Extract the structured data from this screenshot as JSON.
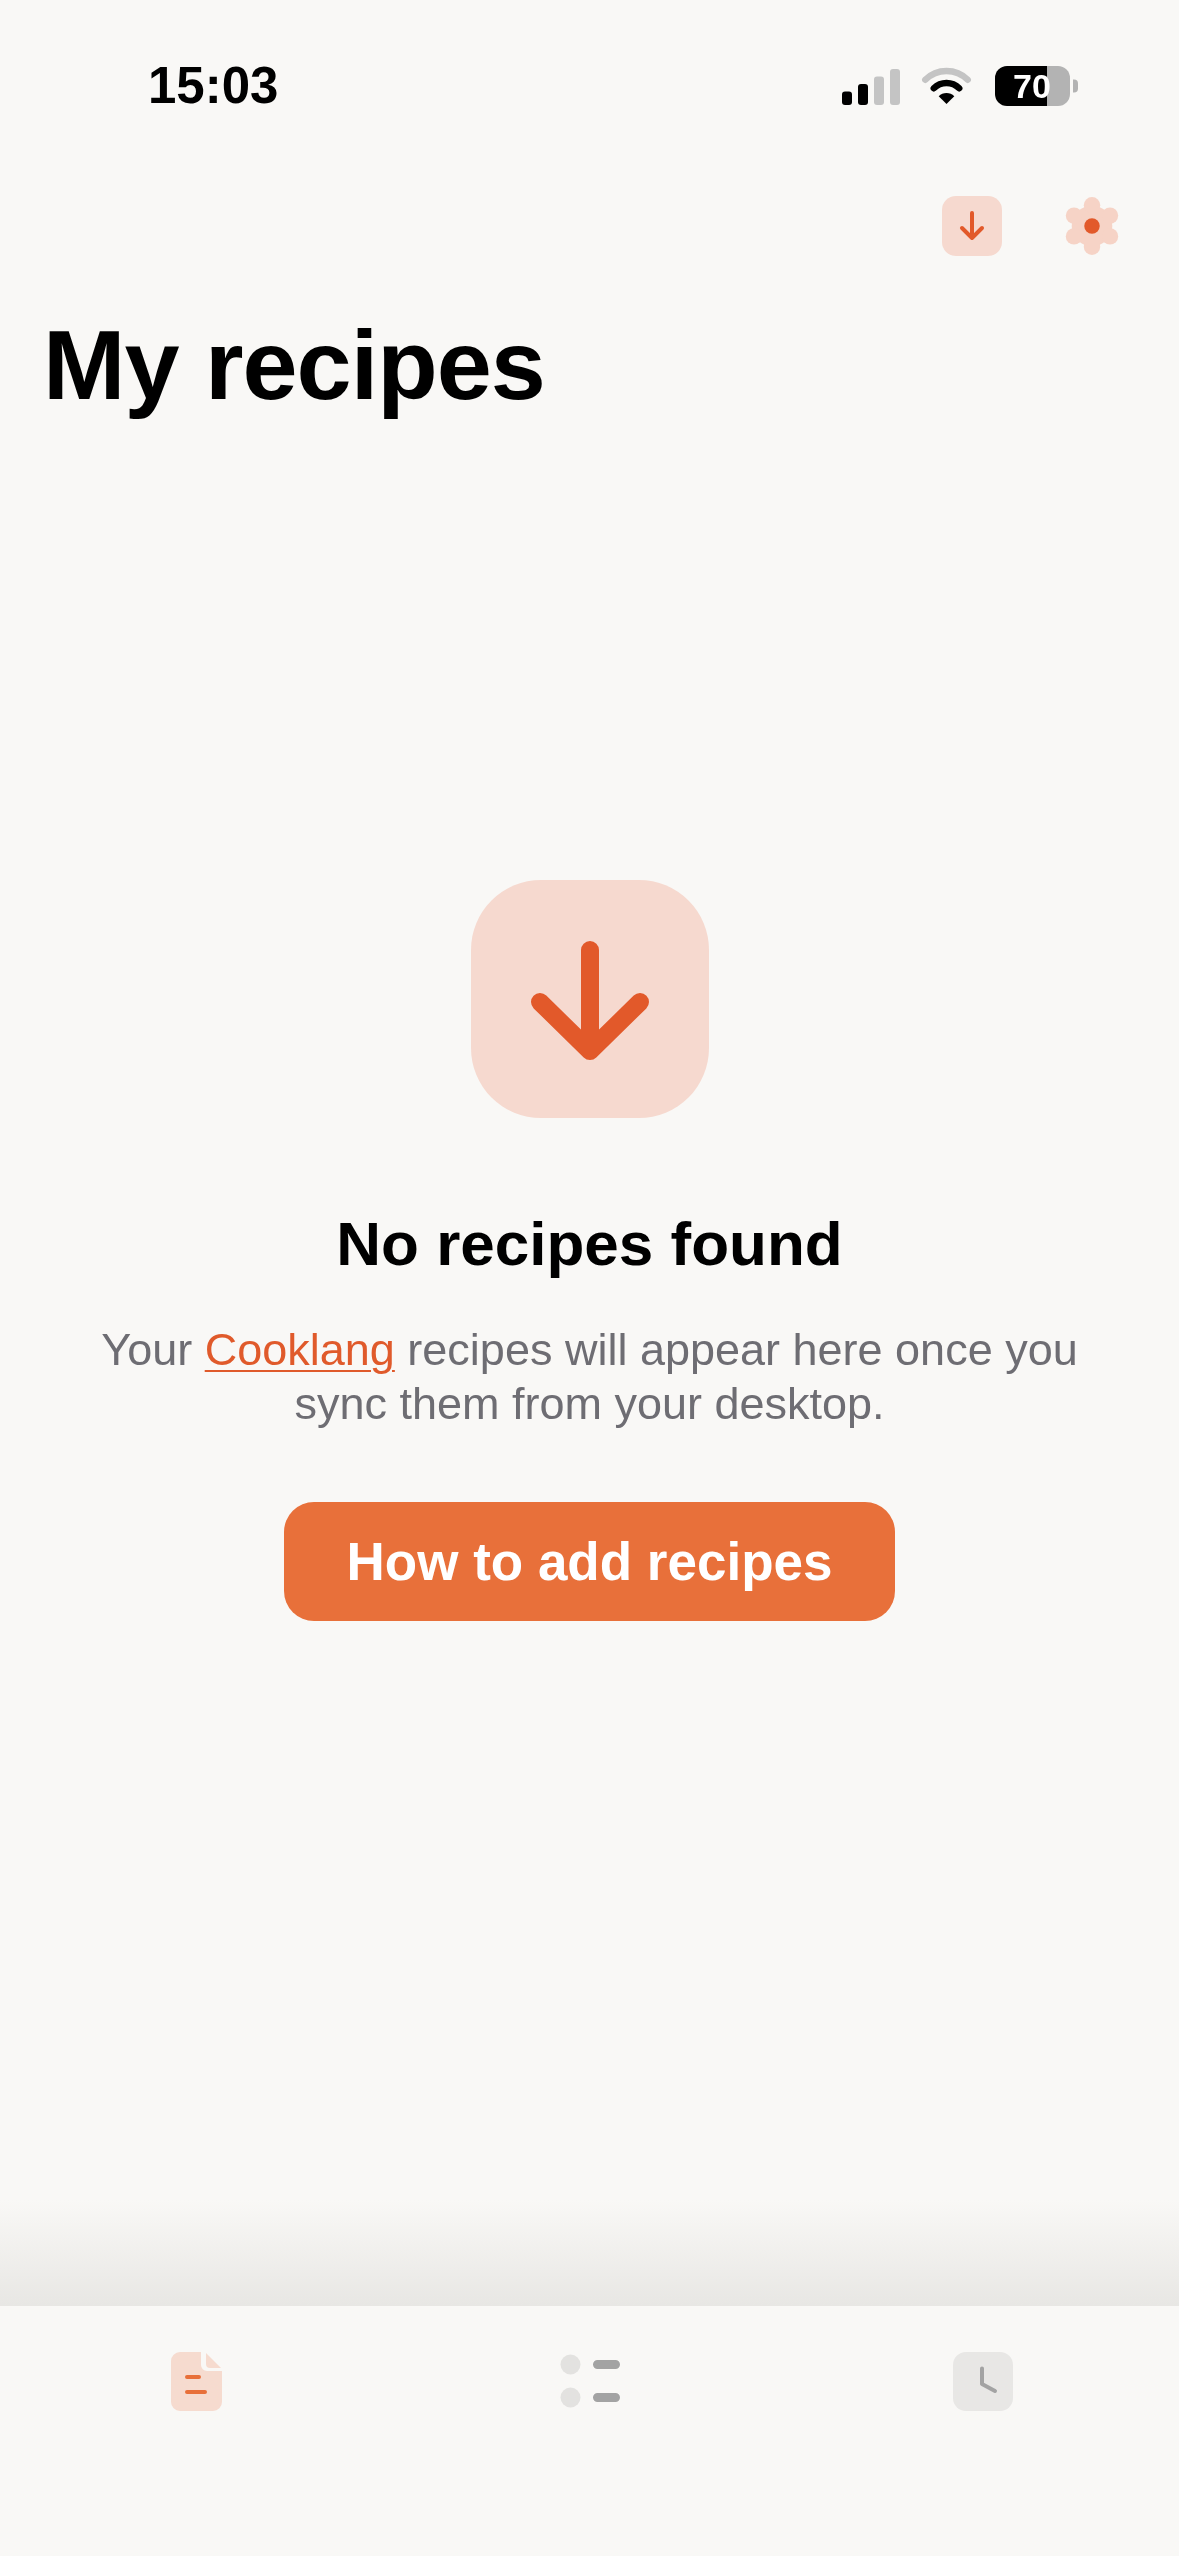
{
  "status_bar": {
    "time": "15:03",
    "battery": "70"
  },
  "header": {
    "actions": [
      {
        "kind": "download"
      },
      {
        "kind": "settings"
      }
    ],
    "title": "My recipes"
  },
  "empty_state": {
    "title": "No recipes found",
    "message_before": "Your",
    "link": "Cooklang",
    "message_after": "recipes will appear here once you sync them from your desktop.",
    "button": "How to add recipes"
  },
  "tab_bar": {
    "tabs": [
      {
        "kind": "document",
        "selected": true
      },
      {
        "kind": "list",
        "selected": false
      },
      {
        "kind": "clock",
        "selected": false
      }
    ]
  }
}
